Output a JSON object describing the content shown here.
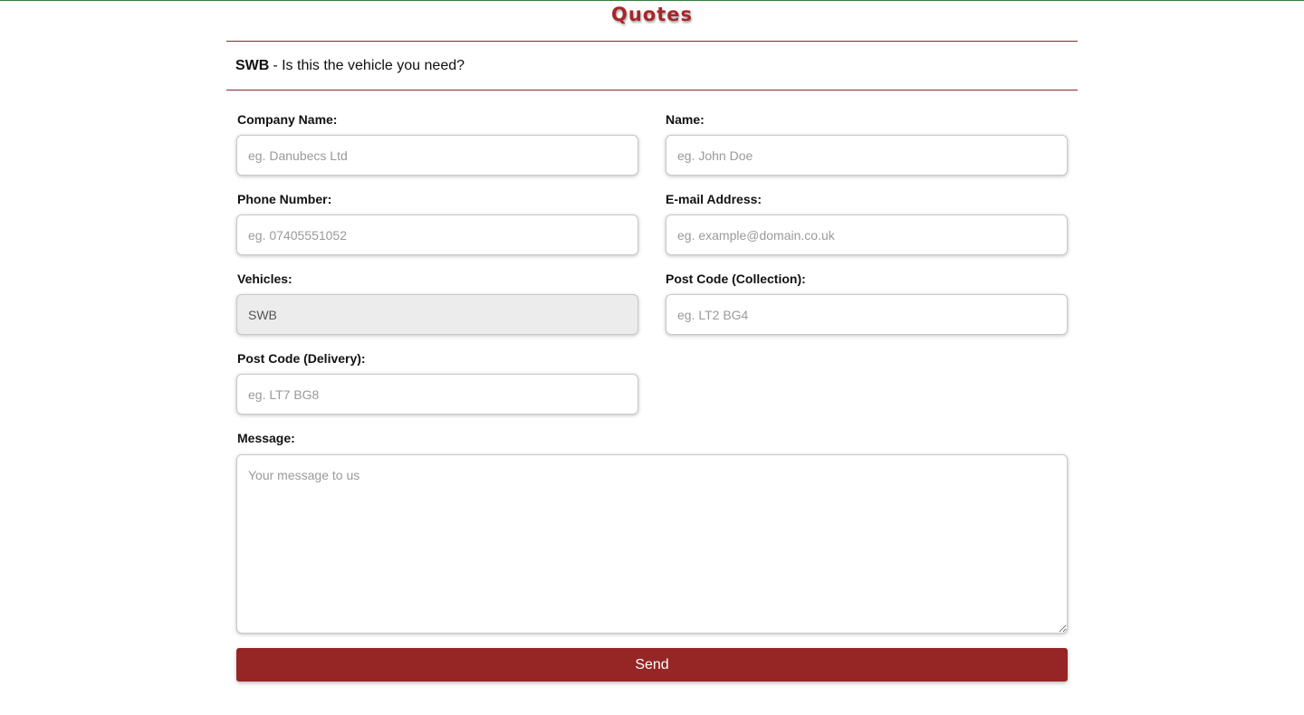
{
  "page": {
    "title": "Quotes",
    "accent_color": "#962626",
    "top_line_color": "#3a7a3a"
  },
  "banner": {
    "vehicle": "SWB",
    "question": "- Is this the vehicle you need?"
  },
  "form": {
    "company_name": {
      "label": "Company Name:",
      "placeholder": "eg. Danubecs Ltd",
      "value": ""
    },
    "name": {
      "label": "Name:",
      "placeholder": "eg. John Doe",
      "value": ""
    },
    "phone": {
      "label": "Phone Number:",
      "placeholder": "eg. 07405551052",
      "value": ""
    },
    "email": {
      "label": "E-mail Address:",
      "placeholder": "eg. example@domain.co.uk",
      "value": ""
    },
    "vehicles": {
      "label": "Vehicles:",
      "value": "SWB"
    },
    "postcode_collection": {
      "label": "Post Code (Collection):",
      "placeholder": "eg. LT2 BG4",
      "value": ""
    },
    "postcode_delivery": {
      "label": "Post Code (Delivery):",
      "placeholder": "eg. LT7 BG8",
      "value": ""
    },
    "message": {
      "label": "Message:",
      "placeholder": "Your message to us",
      "value": ""
    },
    "send_label": "Send"
  }
}
